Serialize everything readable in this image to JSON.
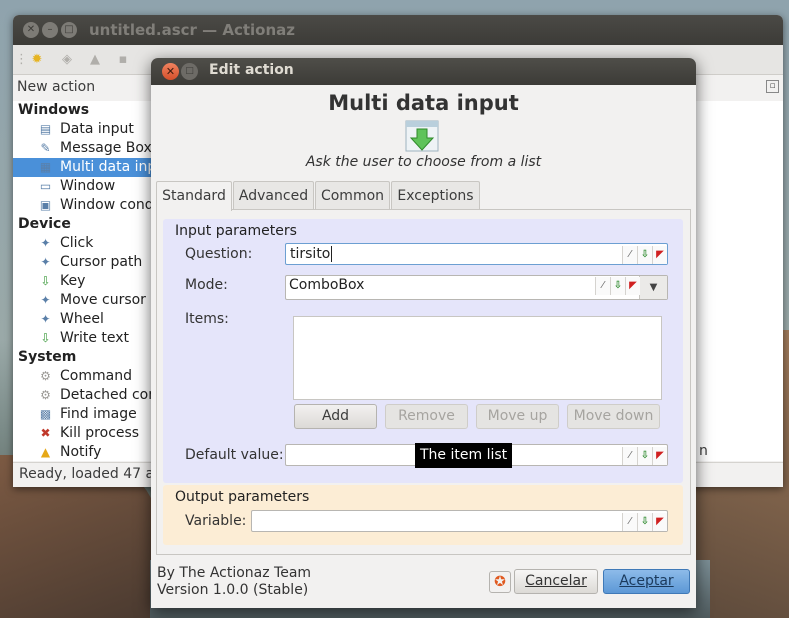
{
  "main_window": {
    "title": "untitled.ascr — Actionaz",
    "new_action_label": "New action",
    "status": "Ready, loaded 47 ac",
    "bg_fragment": "n",
    "categories": [
      {
        "name": "Windows",
        "items": [
          {
            "label": "Data input",
            "icon": "data-input-icon",
            "selected": false
          },
          {
            "label": "Message Box",
            "icon": "message-box-icon",
            "selected": false
          },
          {
            "label": "Multi data inp",
            "icon": "multi-data-input-icon",
            "selected": true
          },
          {
            "label": "Window",
            "icon": "window-icon",
            "selected": false
          },
          {
            "label": "Window cond",
            "icon": "window-condition-icon",
            "selected": false
          }
        ]
      },
      {
        "name": "Device",
        "items": [
          {
            "label": "Click",
            "icon": "click-icon",
            "selected": false
          },
          {
            "label": "Cursor path",
            "icon": "cursor-path-icon",
            "selected": false
          },
          {
            "label": "Key",
            "icon": "key-icon",
            "selected": false
          },
          {
            "label": "Move cursor",
            "icon": "move-cursor-icon",
            "selected": false
          },
          {
            "label": "Wheel",
            "icon": "wheel-icon",
            "selected": false
          },
          {
            "label": "Write text",
            "icon": "write-text-icon",
            "selected": false
          }
        ]
      },
      {
        "name": "System",
        "items": [
          {
            "label": "Command",
            "icon": "gear-icon",
            "selected": false
          },
          {
            "label": "Detached com",
            "icon": "gear-icon",
            "selected": false
          },
          {
            "label": "Find image",
            "icon": "find-image-icon",
            "selected": false
          },
          {
            "label": "Kill process",
            "icon": "kill-process-icon",
            "selected": false
          },
          {
            "label": "Notify",
            "icon": "warning-icon",
            "selected": false
          }
        ]
      }
    ]
  },
  "dialog": {
    "title": "Edit action",
    "heading": "Multi data input",
    "description": "Ask the user to choose from a list",
    "tabs": [
      {
        "label": "Standard",
        "active": true
      },
      {
        "label": "Advanced",
        "active": false
      },
      {
        "label": "Common",
        "active": false
      },
      {
        "label": "Exceptions",
        "active": false
      }
    ],
    "input_group": {
      "title": "Input parameters",
      "question_label": "Question:",
      "question_value": "tirsito",
      "mode_label": "Mode:",
      "mode_value": "ComboBox",
      "items_label": "Items:",
      "buttons": {
        "add": "Add",
        "remove": "Remove",
        "move_up": "Move up",
        "move_down": "Move down"
      },
      "default_label": "Default value:",
      "default_value": ""
    },
    "tooltip": "The item list",
    "output_group": {
      "title": "Output parameters",
      "variable_label": "Variable:",
      "variable_value": ""
    },
    "footer": {
      "author": "By The Actionaz Team",
      "version": "Version 1.0.0 (Stable)",
      "cancel": "Cancelar",
      "accept": "Aceptar"
    }
  },
  "colors": {
    "input_group_bg": "#e5e5fa",
    "output_group_bg": "#fcedd5",
    "selection": "#4a90d9",
    "accept_button": "#5c98d6"
  }
}
